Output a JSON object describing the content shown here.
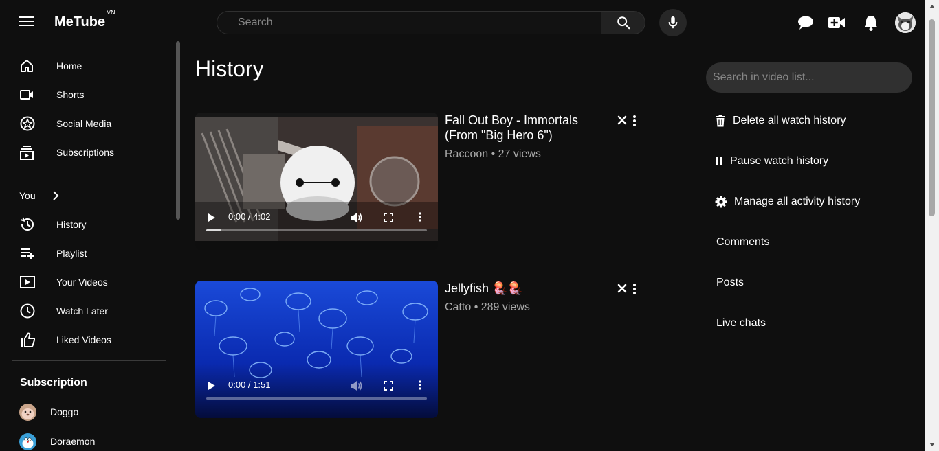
{
  "header": {
    "logo": "MeTube",
    "logo_region": "VN",
    "search_placeholder": "Search"
  },
  "sidebar": {
    "main_items": [
      {
        "label": "Home",
        "icon": "home-icon"
      },
      {
        "label": "Shorts",
        "icon": "shorts-icon"
      },
      {
        "label": "Social Media",
        "icon": "star-icon"
      },
      {
        "label": "Subscriptions",
        "icon": "subscriptions-icon"
      }
    ],
    "you_label": "You",
    "you_items": [
      {
        "label": "History",
        "icon": "history-icon"
      },
      {
        "label": "Playlist",
        "icon": "playlist-add-icon"
      },
      {
        "label": "Your Videos",
        "icon": "your-videos-icon"
      },
      {
        "label": "Watch Later",
        "icon": "clock-icon"
      },
      {
        "label": "Liked Videos",
        "icon": "thumbs-up-icon"
      }
    ],
    "subscription_heading": "Subscription",
    "subscriptions": [
      {
        "name": "Doggo"
      },
      {
        "name": "Doraemon"
      }
    ]
  },
  "main": {
    "title": "History",
    "videos": [
      {
        "title": "Fall Out Boy - Immortals (From \"Big Hero 6\")",
        "meta": "Raccoon • 27 views",
        "time": "0:00 / 4:02",
        "progress": 0.07
      },
      {
        "title": "Jellyfish 🪼🪼",
        "meta": "Catto • 289 views",
        "time": "0:00 / 1:51",
        "progress": 0.0
      }
    ]
  },
  "right_panel": {
    "search_placeholder": "Search in video list...",
    "actions": [
      {
        "label": "Delete all watch history",
        "icon": "trash-icon"
      },
      {
        "label": "Pause watch history",
        "icon": "pause-icon"
      },
      {
        "label": "Manage all activity history",
        "icon": "gear-icon"
      }
    ],
    "links": [
      "Comments",
      "Posts",
      "Live chats"
    ]
  }
}
